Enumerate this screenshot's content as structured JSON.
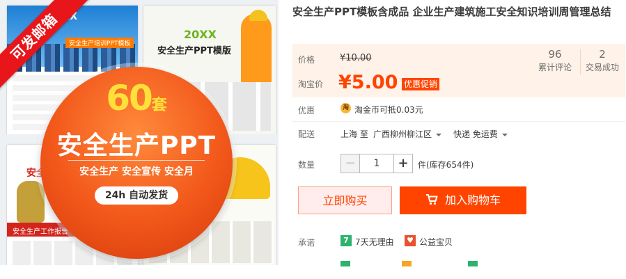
{
  "product_image": {
    "ribbon_text": "可发邮箱",
    "badge_count": "60",
    "badge_unit": "套",
    "badge_title": "安全生产PPT",
    "badge_tags": "安全生产  安全宣传  安全月",
    "badge_pill": "24h 自动发货",
    "slide1_title": "20XX",
    "slide1_subtitle": "安全生产培训PPT模板",
    "slide2_title": "20XX",
    "slide2_subtitle": "安全生产PPT模版",
    "slide3_title": "安全生产",
    "slide3_subtitle": "安全生产工作报告"
  },
  "product": {
    "title": "安全生产PPT模板含成品 企业生产建筑施工安全知识培训周管理总结"
  },
  "price": {
    "label_price": "价格",
    "original": "¥10.00",
    "label_promo": "淘宝价",
    "current": "¥5.00",
    "promo_tag": "优惠促销"
  },
  "stats": [
    {
      "value": "96",
      "label": "累计评论"
    },
    {
      "value": "2",
      "label": "交易成功"
    }
  ],
  "discount": {
    "label": "优惠",
    "coin_icon": "淘",
    "text": "淘金币可抵0.03元"
  },
  "shipping": {
    "label": "配送",
    "from": "上海 至",
    "to": "广西柳州柳江区",
    "method": "快递 免运费"
  },
  "quantity": {
    "label": "数量",
    "minus": "−",
    "value": "1",
    "plus": "+",
    "stock": "件(库存654件)"
  },
  "actions": {
    "buy_now": "立即购买",
    "add_to_cart": "加入购物车"
  },
  "promise": {
    "label": "承诺",
    "items": [
      {
        "icon": "7",
        "text": "7天无理由",
        "color": "#2db36b"
      },
      {
        "icon": "♥",
        "text": "公益宝贝",
        "color": "#e8522e"
      }
    ]
  },
  "colors": {
    "accent": "#ff4400",
    "price_panel_bg": "#fff2e8",
    "buy_btn_bg": "#ffeded"
  }
}
